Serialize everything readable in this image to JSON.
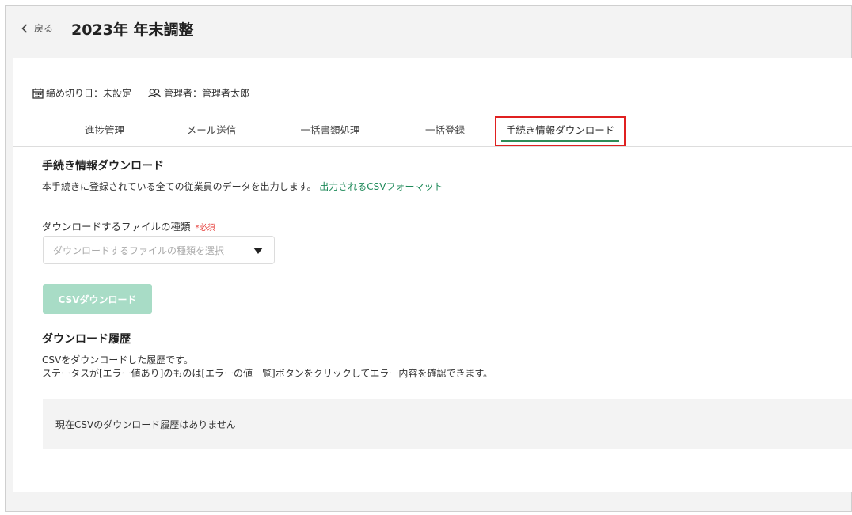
{
  "header": {
    "back_label": "戻る",
    "title": "2023年 年末調整"
  },
  "meta": {
    "deadline": "締め切り日：未設定",
    "manager": "管理者：管理者太郎"
  },
  "tabs": [
    {
      "label": "進捗管理",
      "active": false
    },
    {
      "label": "メール送信",
      "active": false
    },
    {
      "label": "一括書類処理",
      "active": false
    },
    {
      "label": "一括登録",
      "active": false
    },
    {
      "label": "手続き情報ダウンロード",
      "active": true
    }
  ],
  "download": {
    "title": "手続き情報ダウンロード",
    "description": "本手続きに登録されている全ての従業員のデータを出力します。",
    "format_link": "出力されるCSVフォーマット",
    "file_type_label": "ダウンロードするファイルの種類",
    "required_mark": "*必須",
    "select_placeholder": "ダウンロードするファイルの種類を選択",
    "button_label": "CSVダウンロード"
  },
  "history": {
    "title": "ダウンロード履歴",
    "desc_line1": "CSVをダウンロードした履歴です。",
    "desc_line2": "ステータスが[エラー値あり]のものは[エラーの値一覧]ボタンをクリックしてエラー内容を確認できます。",
    "empty_message": "現在CSVのダウンロード履歴はありません"
  },
  "colors": {
    "accent": "#2e8b57",
    "link": "#1f8a5a",
    "button_disabled": "#a8dcc6",
    "highlight": "#e02020",
    "required": "#e53935"
  }
}
